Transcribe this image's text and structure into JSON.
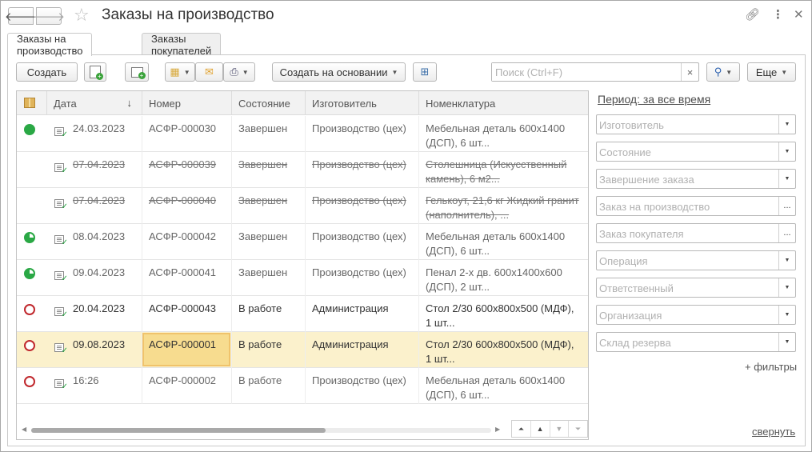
{
  "window": {
    "title": "Заказы на производство",
    "nav": {
      "back": "🡐",
      "forward": "🡒"
    },
    "header_icons": [
      "link-icon",
      "more-vertical-icon",
      "close-icon"
    ]
  },
  "tabs": [
    {
      "label": "Заказы на производство",
      "active": true
    },
    {
      "label": "Заказы покупателей",
      "active": false
    }
  ],
  "toolbar": {
    "create_label": "Создать",
    "create_basis_label": "Создать на основании",
    "more_label": "Еще",
    "search_placeholder": "Поиск (Ctrl+F)",
    "search_clear": "×"
  },
  "table": {
    "columns": [
      "Дата",
      "Номер",
      "Состояние",
      "Изготовитель",
      "Номенклатура"
    ],
    "sort_indicator": "↓",
    "rows": [
      {
        "status": "done",
        "deleted": false,
        "active": false,
        "date": "24.03.2023",
        "number": "АСФР-000030",
        "state": "Завершен",
        "maker": "Производство (цех)",
        "item": "Мебельная деталь 600x1400 (ДСП), 6 шт..."
      },
      {
        "status": "none",
        "deleted": true,
        "active": false,
        "date": "07.04.2023",
        "number": "АСФР-000039",
        "state": "Завершен",
        "maker": "Производство (цех)",
        "item": "Столешница (Искусственный камень), 6 м2..."
      },
      {
        "status": "none",
        "deleted": true,
        "active": false,
        "date": "07.04.2023",
        "number": "АСФР-000040",
        "state": "Завершен",
        "maker": "Производство (цех)",
        "item": "Гелькоут, 21,6 кг Жидкий гранит (наполнитель), ..."
      },
      {
        "status": "partial",
        "deleted": false,
        "active": false,
        "date": "08.04.2023",
        "number": "АСФР-000042",
        "state": "Завершен",
        "maker": "Производство (цех)",
        "item": "Мебельная деталь 600x1400 (ДСП), 6 шт..."
      },
      {
        "status": "partial",
        "deleted": false,
        "active": false,
        "date": "09.04.2023",
        "number": "АСФР-000041",
        "state": "Завершен",
        "maker": "Производство (цех)",
        "item": "Пенал 2-х дв. 600x1400x600 (ДСП), 2 шт..."
      },
      {
        "status": "work",
        "deleted": false,
        "active": true,
        "date": "20.04.2023",
        "number": "АСФР-000043",
        "state": "В работе",
        "maker": "Администрация",
        "item": "Стол 2/30 600x800x500 (МДФ), 1 шт..."
      },
      {
        "status": "work",
        "deleted": false,
        "active": true,
        "selected": true,
        "date": "09.08.2023",
        "number": "АСФР-000001",
        "state": "В работе",
        "maker": "Администрация",
        "item": "Стол 2/30 600x800x500 (МДФ), 1 шт..."
      },
      {
        "status": "work",
        "deleted": false,
        "active": false,
        "date": "16:26",
        "number": "АСФР-000002",
        "state": "В работе",
        "maker": "Производство (цех)",
        "item": "Мебельная деталь 600x1400 (ДСП), 6 шт..."
      }
    ]
  },
  "filters": {
    "period_label": "Период: за все время",
    "fields": [
      {
        "placeholder": "Изготовитель",
        "button": "▼"
      },
      {
        "placeholder": "Состояние",
        "button": "▼"
      },
      {
        "placeholder": "Завершение заказа",
        "button": "▼"
      },
      {
        "placeholder": "Заказ на производство",
        "button": "..."
      },
      {
        "placeholder": "Заказ покупателя",
        "button": "..."
      },
      {
        "placeholder": "Операция",
        "button": "▼"
      },
      {
        "placeholder": "Ответственный",
        "button": "▼"
      },
      {
        "placeholder": "Организация",
        "button": "▼"
      },
      {
        "placeholder": "Склад резерва",
        "button": "▼"
      }
    ],
    "more_label": "+ фильтры",
    "collapse_label": "свернуть"
  }
}
